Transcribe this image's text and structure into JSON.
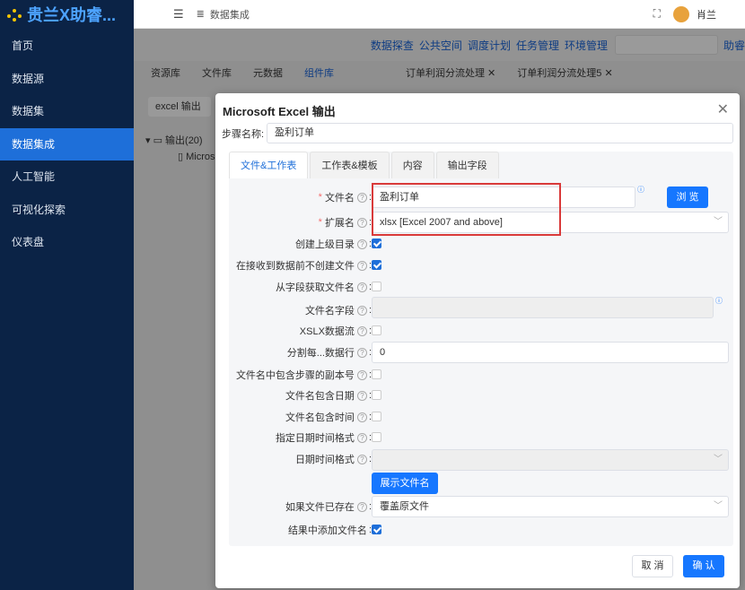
{
  "app": {
    "logo_text": "贵兰X助睿..."
  },
  "sidebar": {
    "items": [
      {
        "label": "首页"
      },
      {
        "label": "数据源"
      },
      {
        "label": "数据集"
      },
      {
        "label": "数据集成"
      },
      {
        "label": "人工智能"
      },
      {
        "label": "可视化探索"
      },
      {
        "label": "仪表盘"
      }
    ]
  },
  "topbar": {
    "breadcrumb": "数据集成",
    "username": "肖兰"
  },
  "subnav": {
    "items": [
      "数据探查",
      "公共空间",
      "调度计划",
      "任务管理",
      "环境管理"
    ],
    "right_text": "助睿"
  },
  "left_tabs": [
    "资源库",
    "文件库",
    "元数据",
    "组件库"
  ],
  "doc_tabs": [
    "订单利润分流处理",
    "订单利润分流处理5"
  ],
  "tree": {
    "search_value": "excel 输出",
    "node": "输出(20)",
    "child": "Micros"
  },
  "modal": {
    "title": "Microsoft Excel 输出",
    "step_name_label": "步骤名称:",
    "step_name_value": "盈利订单",
    "tabs": [
      "文件&工作表",
      "工作表&模板",
      "内容",
      "输出字段"
    ],
    "fields": {
      "filename_label": "文件名",
      "filename_value": "盈利订单",
      "browse": "浏 览",
      "ext_label": "扩展名",
      "ext_value": "xlsx [Excel 2007 and above]",
      "create_parent": "创建上级目录",
      "no_file_before": "在接收到数据前不创建文件",
      "filename_from_field": "从字段获取文件名",
      "filename_field": "文件名字段",
      "xlsx_stream": "XSLX数据流",
      "split_every": "分割每...数据行",
      "split_value": "0",
      "include_stepnr": "文件名中包含步骤的副本号",
      "include_date": "文件名包含日期",
      "include_time": "文件名包含时间",
      "specify_format": "指定日期时间格式",
      "datetime_format": "日期时间格式",
      "show_filename": "展示文件名",
      "if_exists": "如果文件已存在",
      "if_exists_value": "覆盖原文件",
      "add_to_result": "结果中添加文件名"
    },
    "cancel": "取 消",
    "ok": "确 认"
  }
}
